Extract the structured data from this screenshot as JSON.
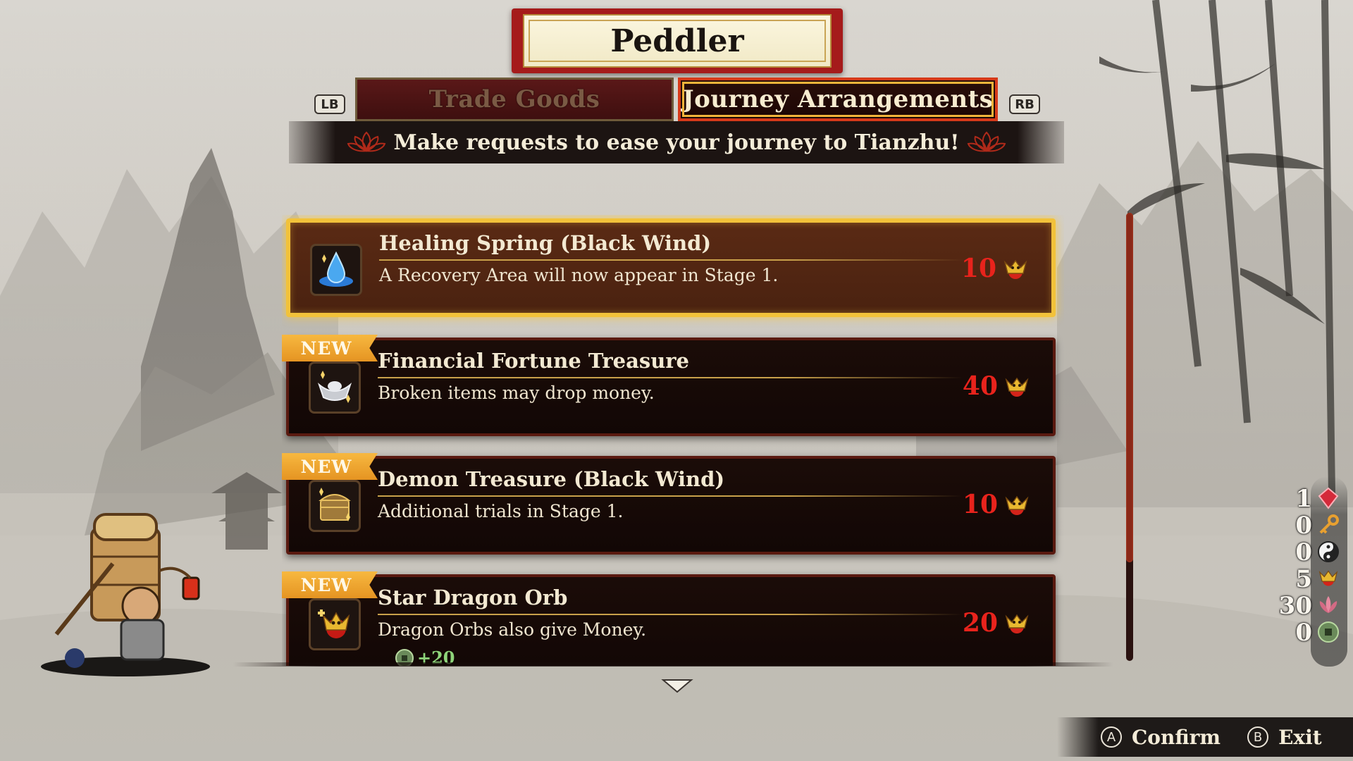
{
  "header": {
    "title": "Peddler"
  },
  "tabs": {
    "left_bumper": "LB",
    "right_bumper": "RB",
    "items": [
      {
        "label": "Trade Goods",
        "active": false
      },
      {
        "label": "Journey Arrangements",
        "active": true
      }
    ]
  },
  "banner": {
    "text": "Make requests to ease your journey to Tianzhu!"
  },
  "arrangements": [
    {
      "name": "Healing Spring (Black Wind)",
      "description": "A Recovery Area will now appear in Stage 1.",
      "cost": "10",
      "new": false,
      "selected": true,
      "icon": "healing-spring-icon"
    },
    {
      "name": "Financial Fortune Treasure",
      "description": "Broken items may drop money.",
      "cost": "40",
      "new": true,
      "new_label": "NEW",
      "selected": false,
      "icon": "silver-ingot-icon"
    },
    {
      "name": "Demon Treasure (Black Wind)",
      "description": "Additional trials in Stage 1.",
      "cost": "10",
      "new": true,
      "new_label": "NEW",
      "selected": false,
      "icon": "treasure-chest-icon"
    },
    {
      "name": "Star Dragon Orb",
      "description": "Dragon Orbs also give Money.",
      "cost": "20",
      "new": true,
      "new_label": "NEW",
      "selected": false,
      "icon": "dragon-orb-icon",
      "bonus": "+20"
    }
  ],
  "scrollbar": {
    "visible_fraction": 0.78,
    "position": 0.0
  },
  "resources": [
    {
      "value": "1",
      "icon": "red-gem-icon"
    },
    {
      "value": "0",
      "icon": "key-icon"
    },
    {
      "value": "0",
      "icon": "yin-yang-icon"
    },
    {
      "value": "5",
      "icon": "dragon-coin-icon"
    },
    {
      "value": "30",
      "icon": "lotus-icon"
    },
    {
      "value": "0",
      "icon": "jade-coin-icon"
    }
  ],
  "footer": {
    "confirm_glyph": "A",
    "confirm_label": "Confirm",
    "exit_glyph": "B",
    "exit_label": "Exit"
  },
  "colors": {
    "accent_red": "#e8231c",
    "gold": "#f2c23a",
    "new_tag": "#f0a830",
    "card_bg": "#1b0c08"
  }
}
